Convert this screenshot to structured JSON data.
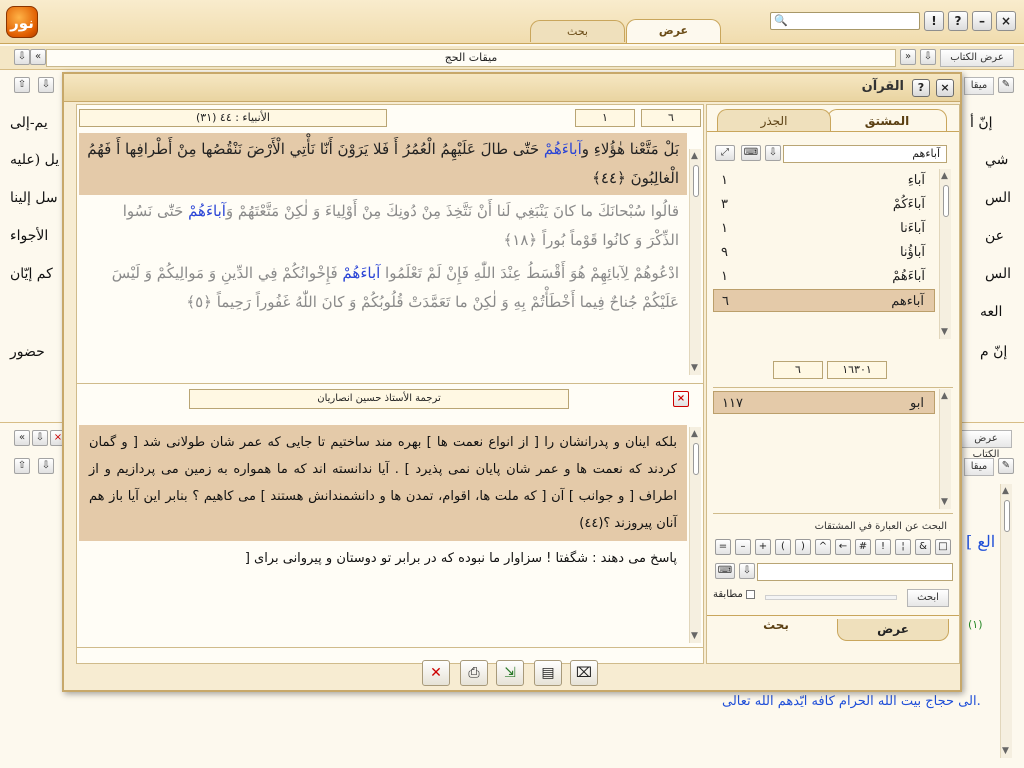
{
  "app": {
    "tabs": {
      "view": "عرض",
      "search": "بحث"
    },
    "logo_text": "نور",
    "top_buttons": [
      "!",
      "?",
      "–",
      "×"
    ]
  },
  "background": {
    "book_title": "ميقات الحج",
    "book_view_label": "عرض الكتاب",
    "button_label": "ميقا",
    "lines_left": [
      "يم-إلى",
      "يل (عليه",
      "سل إلينا",
      "الأجواء",
      "كم إيّان",
      "حضور"
    ],
    "lines_right": [
      "إنّ أ",
      "شي",
      "الس",
      "عن",
      "الس",
      "العه",
      "إنّ م"
    ],
    "bottom_line": "الى حجاج بيت الله الحرام كافه ايّدهم الله تعالى.",
    "side_bracket": "[ الع",
    "verse_marker": "(١)"
  },
  "modal": {
    "title": "القرآن",
    "surah_field": "(٣١) الأنبياء : ٤٤",
    "verse_from": "١",
    "verse_to": "٦",
    "ayat": [
      {
        "text_pre": "بَلْ مَتَّعْنا هٰؤُلاءِ و",
        "text_hl": "آباءَهُمْ",
        "text_post": " حَتّٰى طالَ عَلَيْهِمُ الْعُمُرُ أَ فَلا يَرَوْنَ أَنّا نَأْتِي الْأَرْضَ نَنْقُصُها مِنْ أَطْرافِها أَ فَهُمُ الْغالِبُونَ ﴿٤٤﴾"
      },
      {
        "text_pre": "قالُوا سُبْحانَكَ ما كانَ يَنْبَغِي لَنا أَنْ نَتَّخِذَ مِنْ دُونِكَ مِنْ أَوْلِياءَ وَ لٰكِنْ مَتَّعْتَهُمْ وَ",
        "text_hl": "آباءَهُمْ",
        "text_post": " حَتّٰى نَسُوا الذِّكْرَ وَ كانُوا قَوْماً بُوراً ﴿١٨﴾"
      },
      {
        "text_pre": "ادْعُوهُمْ لِآبائِهِمْ هُوَ أَقْسَطُ عِنْدَ اللّٰهِ فَإِنْ لَمْ تَعْلَمُوا ",
        "text_hl": "آباءَهُمْ",
        "text_post": " فَإِخْوانُكُمْ فِي الدِّينِ وَ مَوالِيكُمْ وَ لَيْسَ عَلَيْكُمْ جُناحٌ فِيما أَخْطَأْتُمْ بِهِ وَ لٰكِنْ ما تَعَمَّدَتْ قُلُوبُكُمْ وَ كانَ اللّٰهُ غَفُوراً رَحِيماً ﴿٥﴾"
      }
    ],
    "translation_title": "ترجمة الأستاذ حسين انصاريان",
    "translation": [
      "بلکه اينان و پدرانشان را [ از انواع نعمت ها ] بهره مند ساختيم تا جايى که عمر شان طولانى شد [ و گمان کردند که نعمت ها و عمر شان پايان نمى پذيرد ] . آيا ندانسته اند که ما همواره به زمين مى پردازيم و از اطراف [ و جوانب ] آن [ که ملت ها، اقوام، تمدن ها و دانشمندانش هستند ] مى کاهيم ؟ بنابر اين آيا باز هم آنان پيروزند ؟(٤٤)",
      "پاسخ مى دهند : شگفتا ! سزاوار ما نبوده که در برابر تو دوستان و پيروانى براى ["
    ],
    "right": {
      "tab_derived": "المشتق",
      "tab_root": "الجذر",
      "search_word": "آباءهم",
      "derivatives": [
        {
          "word": "آباءِ",
          "count": "١"
        },
        {
          "word": "آباءَكُمْ",
          "count": "٣"
        },
        {
          "word": "آباءَنا",
          "count": "١"
        },
        {
          "word": "آباؤُنا",
          "count": "٩"
        },
        {
          "word": "آباءَهُمْ",
          "count": "١"
        },
        {
          "word": "آباءهم",
          "count": "٦"
        }
      ],
      "counter_left": "٦",
      "counter_right": "١٦٣٠١",
      "root": {
        "word": "ابو",
        "count": "١١٧"
      },
      "phrase_label": "البحث عن العبارة في المشتقات",
      "operators": [
        "=",
        "–",
        "+",
        "(",
        ")",
        "^",
        "←",
        "#",
        "!",
        "¦",
        "&",
        "□"
      ],
      "match_label": "مطابقة",
      "search_button": "ابحث",
      "bottom_tab_view": "عرض",
      "bottom_tab_search": "بحث"
    }
  }
}
